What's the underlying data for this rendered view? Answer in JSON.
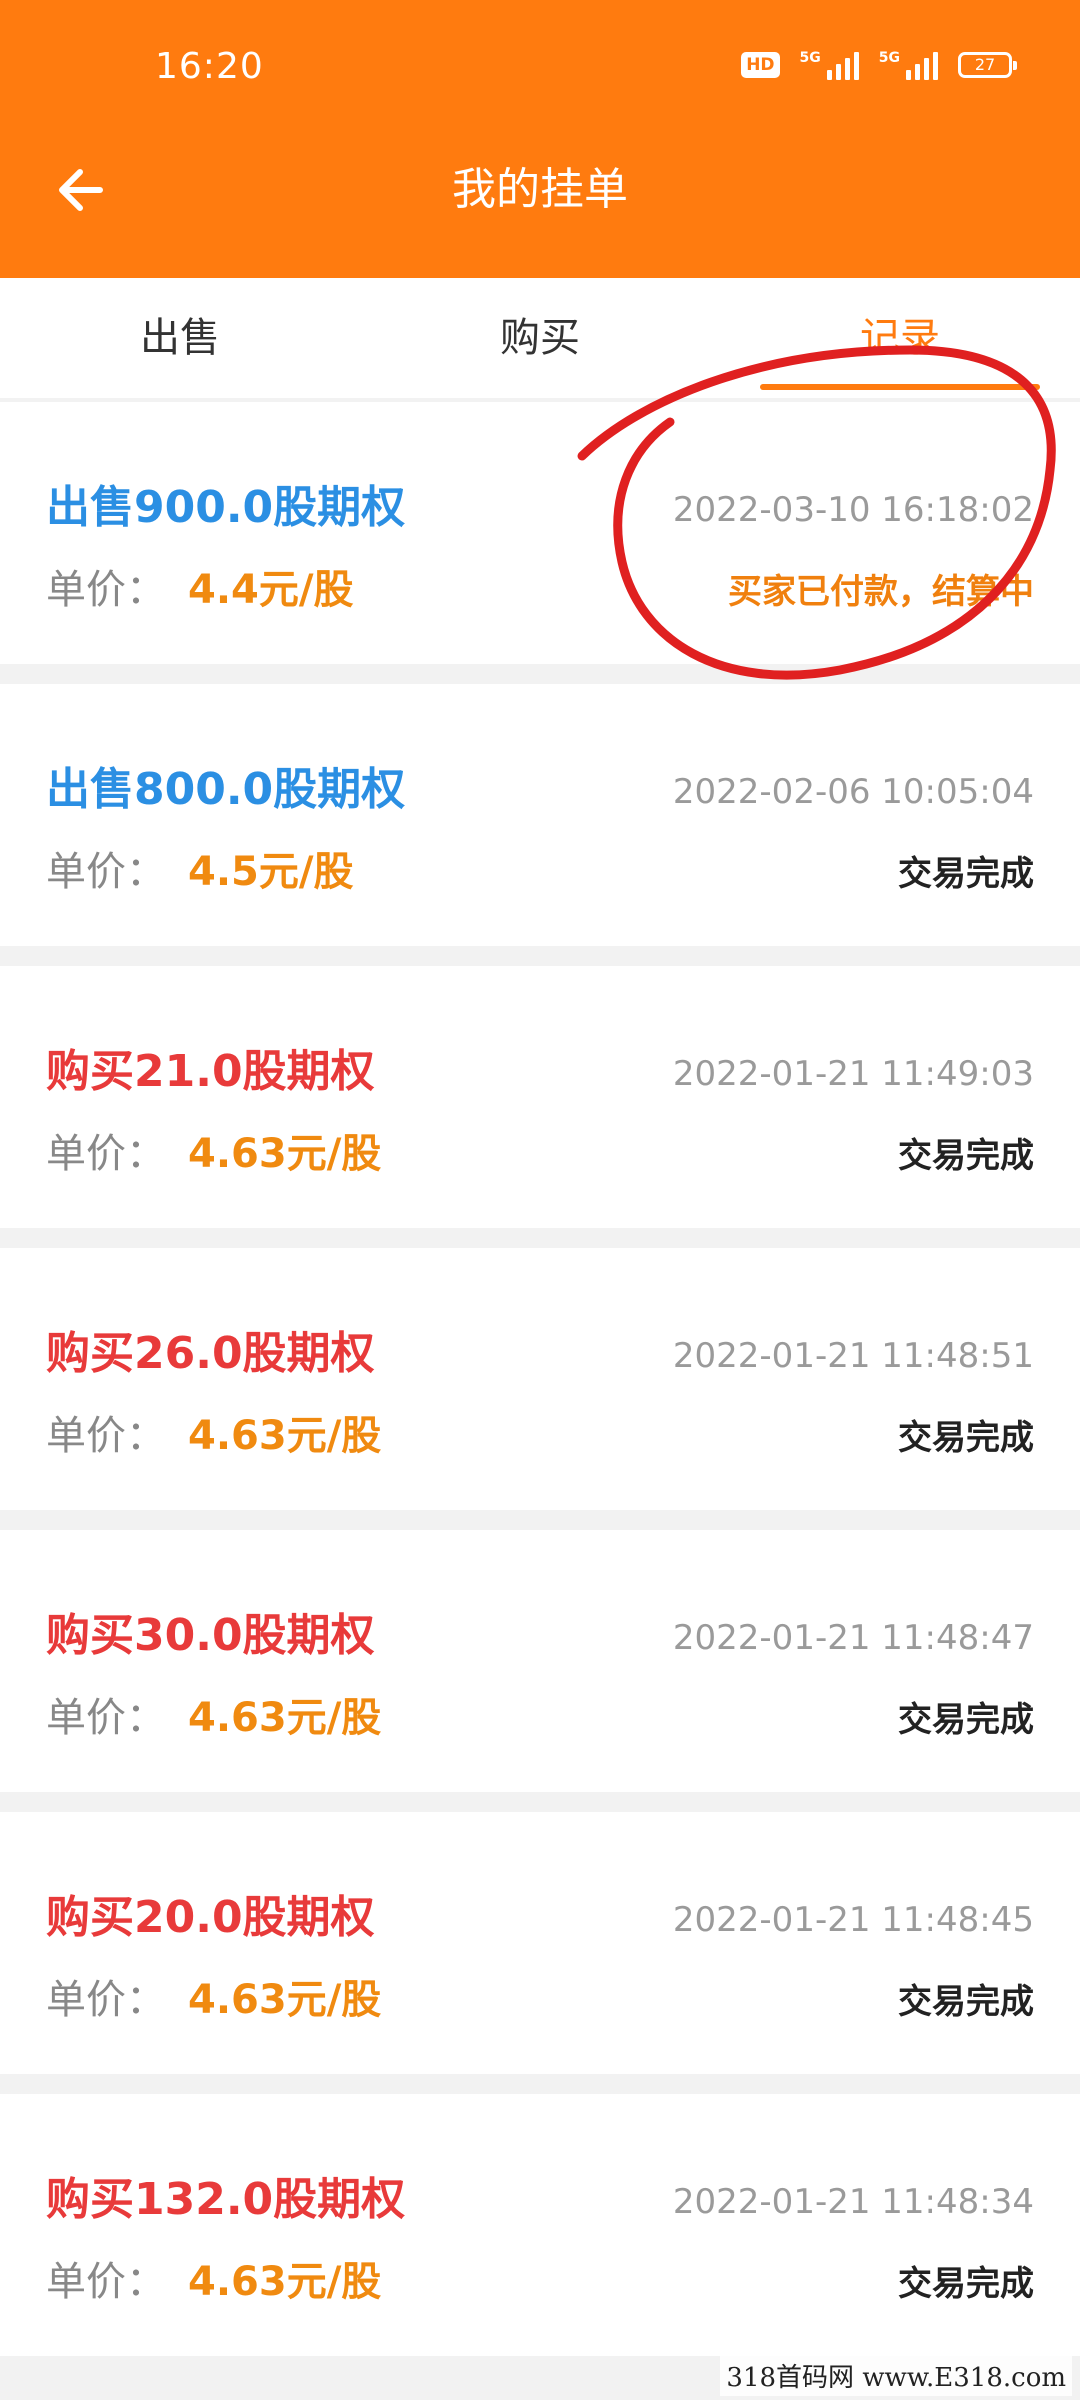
{
  "status_bar": {
    "time": "16:20",
    "hd_label": "HD",
    "network_1": "5G",
    "network_2": "5G",
    "battery": "27"
  },
  "header": {
    "title": "我的挂单",
    "back_icon": "arrow-left-icon"
  },
  "tabs": [
    {
      "label": "出售",
      "active": false
    },
    {
      "label": "购买",
      "active": false
    },
    {
      "label": "记录",
      "active": true
    }
  ],
  "colors": {
    "brand": "#ff7b0f",
    "sell": "#2b8fe3",
    "buy": "#e83a3a",
    "price": "#f08a10",
    "annotation": "#e02020"
  },
  "price_label": "单价：",
  "records": [
    {
      "title": "出售900.0股期权",
      "type": "sell",
      "price": "4.4元/股",
      "date": "2022-03-10 16:18:02",
      "status": "买家已付款，结算中"
    },
    {
      "title": "出售800.0股期权",
      "type": "sell",
      "price": "4.5元/股",
      "date": "2022-02-06 10:05:04",
      "status": "交易完成"
    },
    {
      "title": "购买21.0股期权",
      "type": "buy",
      "price": "4.63元/股",
      "date": "2022-01-21 11:49:03",
      "status": "交易完成"
    },
    {
      "title": "购买26.0股期权",
      "type": "buy",
      "price": "4.63元/股",
      "date": "2022-01-21 11:48:51",
      "status": "交易完成"
    },
    {
      "title": "购买30.0股期权",
      "type": "buy",
      "price": "4.63元/股",
      "date": "2022-01-21 11:48:47",
      "status": "交易完成"
    },
    {
      "title": "购买20.0股期权",
      "type": "buy",
      "price": "4.63元/股",
      "date": "2022-01-21 11:48:45",
      "status": "交易完成"
    },
    {
      "title": "购买132.0股期权",
      "type": "buy",
      "price": "4.63元/股",
      "date": "2022-01-21 11:48:34",
      "status": "交易完成"
    }
  ],
  "watermark": "318首码网 www.E318.com"
}
